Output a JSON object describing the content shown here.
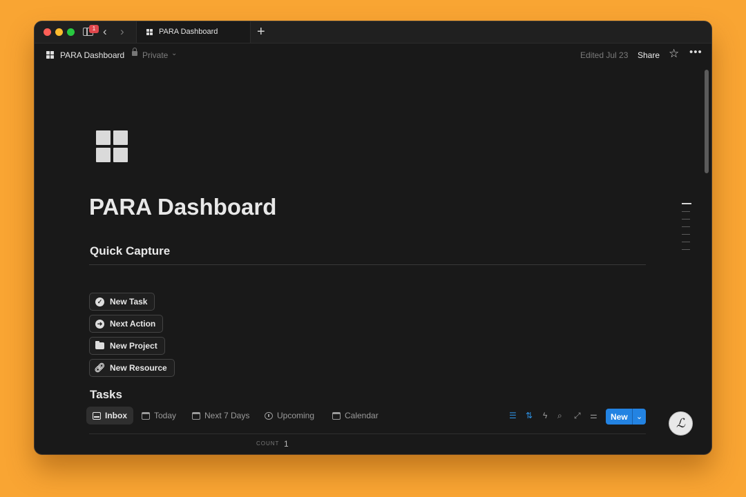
{
  "browser": {
    "tab_title": "PARA Dashboard",
    "notification_count": "1",
    "nav_back": "‹",
    "nav_forward": "›",
    "new_tab": "+"
  },
  "header": {
    "title": "PARA Dashboard",
    "privacy": "Private",
    "edited": "Edited Jul 23",
    "share": "Share"
  },
  "page": {
    "title": "PARA Dashboard",
    "quick_capture_heading": "Quick Capture",
    "quick_capture_buttons": [
      {
        "label": "New Task",
        "icon": "check-circle-icon"
      },
      {
        "label": "Next Action",
        "icon": "arrow-right-circle-icon"
      },
      {
        "label": "New Project",
        "icon": "folder-icon"
      },
      {
        "label": "New Resource",
        "icon": "link-icon"
      }
    ],
    "tasks_heading": "Tasks",
    "task_views": [
      {
        "label": "Inbox",
        "icon": "inbox-icon",
        "active": true
      },
      {
        "label": "Today",
        "icon": "calendar-icon",
        "active": false
      },
      {
        "label": "Next 7 Days",
        "icon": "calendar-icon",
        "active": false
      },
      {
        "label": "Upcoming",
        "icon": "clock-icon",
        "active": false
      },
      {
        "label": "Calendar",
        "icon": "calendar-icon",
        "active": false
      }
    ],
    "new_button": "New",
    "count_label": "COUNT",
    "count_value": "1"
  },
  "colors": {
    "background": "#F9A533",
    "window": "#191919",
    "accent": "#2383E2"
  }
}
